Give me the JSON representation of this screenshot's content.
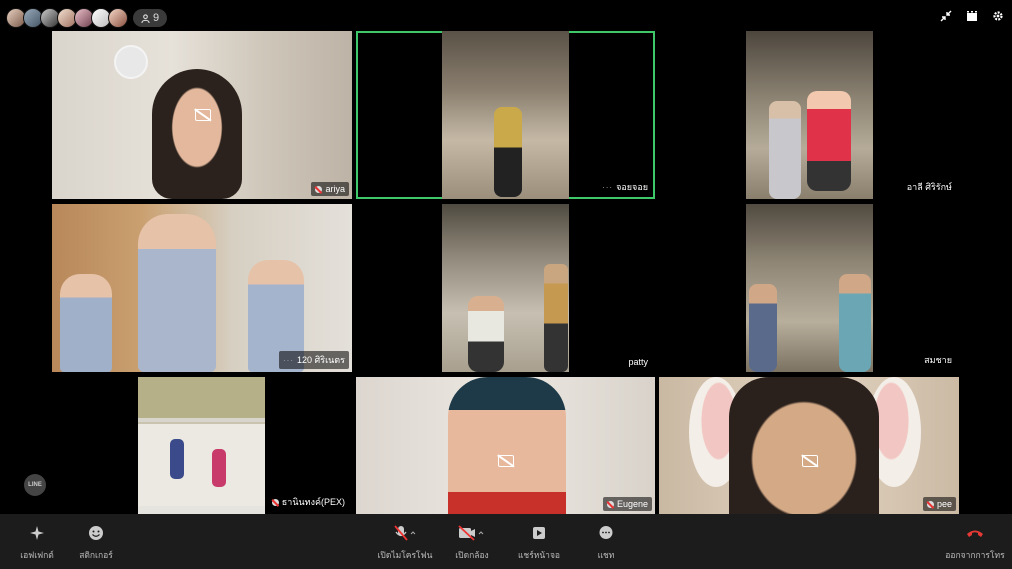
{
  "app": {
    "participant_count": "9"
  },
  "participants": [
    {
      "name": "ariya"
    },
    {
      "name": "จอยจอย"
    },
    {
      "name": "อาลี ศิริรักษ์"
    },
    {
      "name": "120 ศิริเนตร"
    },
    {
      "name": "patty"
    },
    {
      "name": "สมชาย"
    },
    {
      "name": "ธานินทงค์(PEX)"
    },
    {
      "name": "Eugene"
    },
    {
      "name": "pee"
    }
  ],
  "toolbar": {
    "effects": "เอฟเฟกต์",
    "stickers": "สติกเกอร์",
    "mic": "เปิดไมโครโฟน",
    "camera": "เปิดกล้อง",
    "share": "แชร์หน้าจอ",
    "chat": "แชท",
    "leave": "ออกจากการโทร"
  },
  "brand": {
    "line_badge": "LINE"
  },
  "colors": {
    "active_border": "#3ec86a",
    "leave": "#e53935",
    "muted": "#e33"
  }
}
